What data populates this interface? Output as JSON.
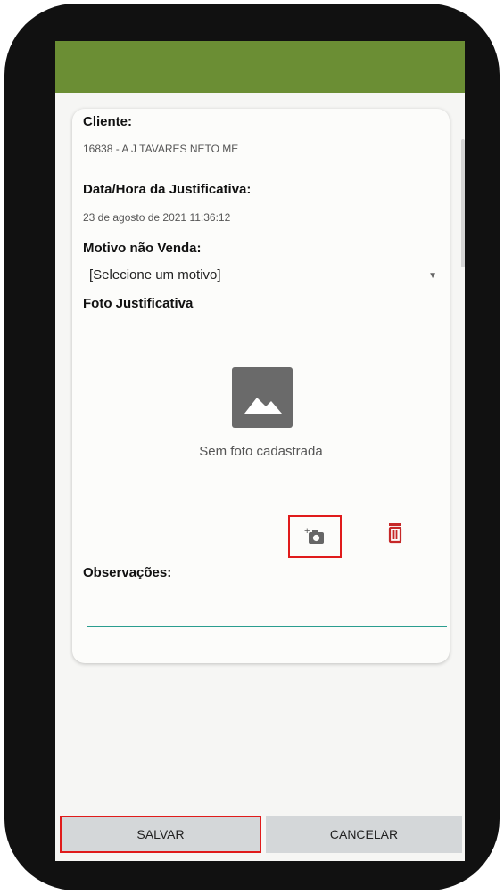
{
  "form": {
    "cliente_label": "Cliente:",
    "cliente_value": "16838 - A J TAVARES NETO ME",
    "datahora_label": "Data/Hora da Justificativa:",
    "datahora_value": "23 de agosto de 2021 11:36:12",
    "motivo_label": "Motivo não Venda:",
    "motivo_value": "[Selecione um motivo]",
    "foto_label": "Foto Justificativa",
    "foto_placeholder": "Sem foto cadastrada",
    "observacoes_label": "Observações:",
    "observacoes_value": ""
  },
  "buttons": {
    "save": "SALVAR",
    "cancel": "CANCELAR"
  },
  "icons": {
    "photo": "image-placeholder-icon",
    "camera": "add-photo-icon",
    "delete": "trash-icon",
    "dropdown": "chevron-down-icon"
  },
  "colors": {
    "app_bar": "#6b8e34",
    "accent_line": "#2a9d8f",
    "delete": "#c62828",
    "highlight_box": "#e01b1b"
  }
}
